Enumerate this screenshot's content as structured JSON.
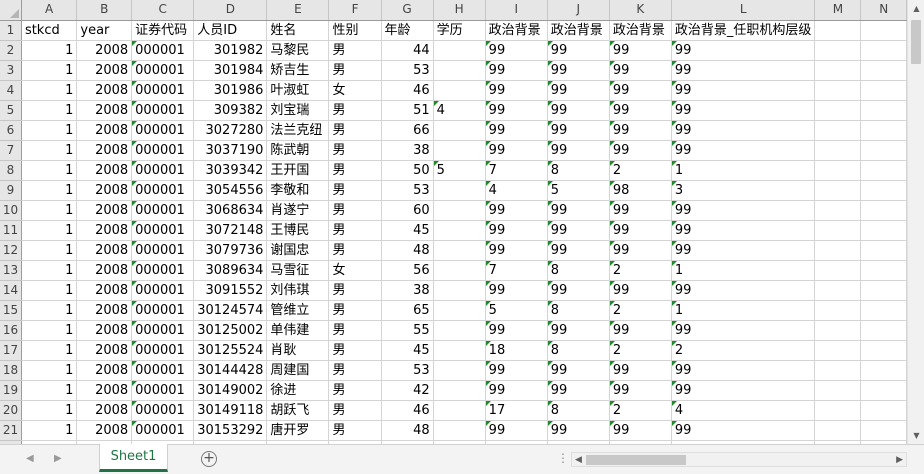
{
  "columns": [
    "A",
    "B",
    "C",
    "D",
    "E",
    "F",
    "G",
    "H",
    "I",
    "J",
    "K",
    "L",
    "M",
    "N"
  ],
  "headers": [
    "stkcd",
    "year",
    "证券代码",
    "人员ID",
    "姓名",
    "性别",
    "年龄",
    "学历",
    "政治背景",
    "政治背景",
    "政治背景",
    "政治背景_任职机构层级",
    "",
    ""
  ],
  "rows": [
    {
      "n": "2",
      "c": [
        "1",
        "2008",
        "000001",
        "301982",
        "马黎民",
        "男",
        "44",
        "",
        "99",
        "99",
        "99",
        "99"
      ]
    },
    {
      "n": "3",
      "c": [
        "1",
        "2008",
        "000001",
        "301984",
        "矫吉生",
        "男",
        "53",
        "",
        "99",
        "99",
        "99",
        "99"
      ]
    },
    {
      "n": "4",
      "c": [
        "1",
        "2008",
        "000001",
        "301986",
        "叶淑虹",
        "女",
        "46",
        "",
        "99",
        "99",
        "99",
        "99"
      ]
    },
    {
      "n": "5",
      "c": [
        "1",
        "2008",
        "000001",
        "309382",
        "刘宝瑞",
        "男",
        "51",
        "4",
        "99",
        "99",
        "99",
        "99"
      ]
    },
    {
      "n": "6",
      "c": [
        "1",
        "2008",
        "000001",
        "3027280",
        "法兰克纽",
        "男",
        "66",
        "",
        "99",
        "99",
        "99",
        "99"
      ]
    },
    {
      "n": "7",
      "c": [
        "1",
        "2008",
        "000001",
        "3037190",
        "陈武朝",
        "男",
        "38",
        "",
        "99",
        "99",
        "99",
        "99"
      ]
    },
    {
      "n": "8",
      "c": [
        "1",
        "2008",
        "000001",
        "3039342",
        "王开国",
        "男",
        "50",
        "5",
        "7",
        "8",
        "2",
        "1"
      ]
    },
    {
      "n": "9",
      "c": [
        "1",
        "2008",
        "000001",
        "3054556",
        "李敬和",
        "男",
        "53",
        "",
        "4",
        "5",
        "98",
        "3"
      ]
    },
    {
      "n": "10",
      "c": [
        "1",
        "2008",
        "000001",
        "3068634",
        "肖遂宁",
        "男",
        "60",
        "",
        "99",
        "99",
        "99",
        "99"
      ]
    },
    {
      "n": "11",
      "c": [
        "1",
        "2008",
        "000001",
        "3072148",
        "王博民",
        "男",
        "45",
        "",
        "99",
        "99",
        "99",
        "99"
      ]
    },
    {
      "n": "12",
      "c": [
        "1",
        "2008",
        "000001",
        "3079736",
        "谢国忠",
        "男",
        "48",
        "",
        "99",
        "99",
        "99",
        "99"
      ]
    },
    {
      "n": "13",
      "c": [
        "1",
        "2008",
        "000001",
        "3089634",
        "马雪征",
        "女",
        "56",
        "",
        "7",
        "8",
        "2",
        "1"
      ]
    },
    {
      "n": "14",
      "c": [
        "1",
        "2008",
        "000001",
        "3091552",
        "刘伟琪",
        "男",
        "38",
        "",
        "99",
        "99",
        "99",
        "99"
      ]
    },
    {
      "n": "15",
      "c": [
        "1",
        "2008",
        "000001",
        "30124574",
        "管维立",
        "男",
        "65",
        "",
        "5",
        "8",
        "2",
        "1"
      ]
    },
    {
      "n": "16",
      "c": [
        "1",
        "2008",
        "000001",
        "30125002",
        "单伟建",
        "男",
        "55",
        "",
        "99",
        "99",
        "99",
        "99"
      ]
    },
    {
      "n": "17",
      "c": [
        "1",
        "2008",
        "000001",
        "30125524",
        "肖耿",
        "男",
        "45",
        "",
        "18",
        "8",
        "2",
        "2"
      ]
    },
    {
      "n": "18",
      "c": [
        "1",
        "2008",
        "000001",
        "30144428",
        "周建国",
        "男",
        "53",
        "",
        "99",
        "99",
        "99",
        "99"
      ]
    },
    {
      "n": "19",
      "c": [
        "1",
        "2008",
        "000001",
        "30149002",
        "徐进",
        "男",
        "42",
        "",
        "99",
        "99",
        "99",
        "99"
      ]
    },
    {
      "n": "20",
      "c": [
        "1",
        "2008",
        "000001",
        "30149118",
        "胡跃飞",
        "男",
        "46",
        "",
        "17",
        "8",
        "2",
        "4"
      ]
    },
    {
      "n": "21",
      "c": [
        "1",
        "2008",
        "000001",
        "30153292",
        "唐开罗",
        "男",
        "48",
        "",
        "99",
        "99",
        "99",
        "99"
      ]
    }
  ],
  "bottom": {
    "sheet_tab": "Sheet1",
    "add_sheet": "⊕",
    "dots": "⋮"
  },
  "colors": {
    "accent": "#217346",
    "triangle": "#1e8c2c",
    "header_bg": "#e6e6e6"
  }
}
